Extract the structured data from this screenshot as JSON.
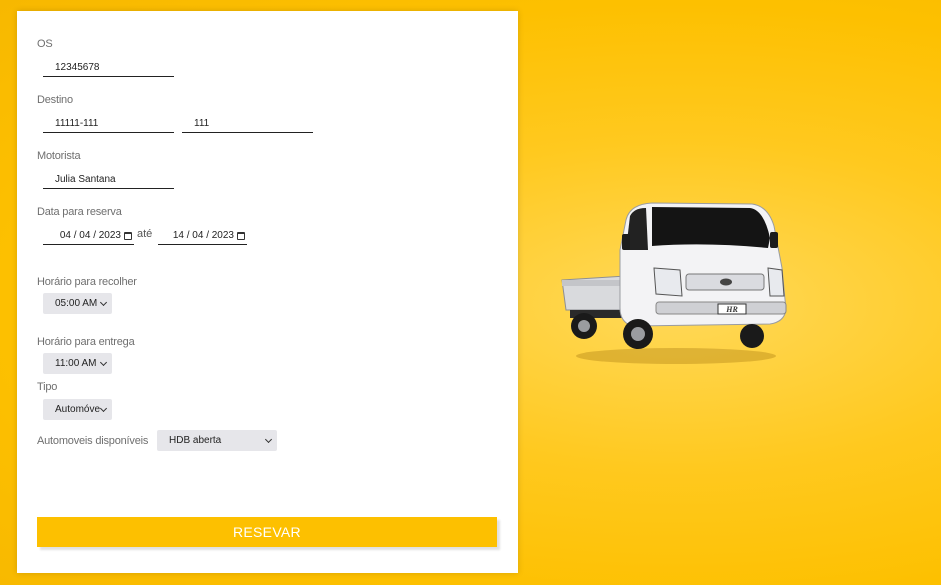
{
  "form": {
    "os_label": "OS",
    "os_value": "12345678",
    "destino_label": "Destino",
    "destino_cep": "11111-111",
    "destino_numero": "111",
    "motorista_label": "Motorista",
    "motorista_value": "Julia Santana",
    "data_label": "Data para reserva",
    "data_inicio": "04 / 04 / 2023",
    "ate_label": "até",
    "data_fim": "14 / 04 / 2023",
    "recolher_label": "Horário para recolher",
    "recolher_value": "05:00 AM",
    "entrega_label": "Horário para entrega",
    "entrega_value": "11:00 AM",
    "tipo_label": "Tipo",
    "tipo_value": "Automóve",
    "automoveis_label": "Automoveis disponíveis",
    "automoveis_value": "HDB aberta",
    "submit_label": "RESEVAR"
  },
  "hero": {
    "image": "white-pickup-truck-image",
    "truck_badge": "HR"
  },
  "colors": {
    "accent": "#fdc000",
    "background": "#ffc91f",
    "card": "#ffffff",
    "select_bg": "#e6e6ea"
  }
}
